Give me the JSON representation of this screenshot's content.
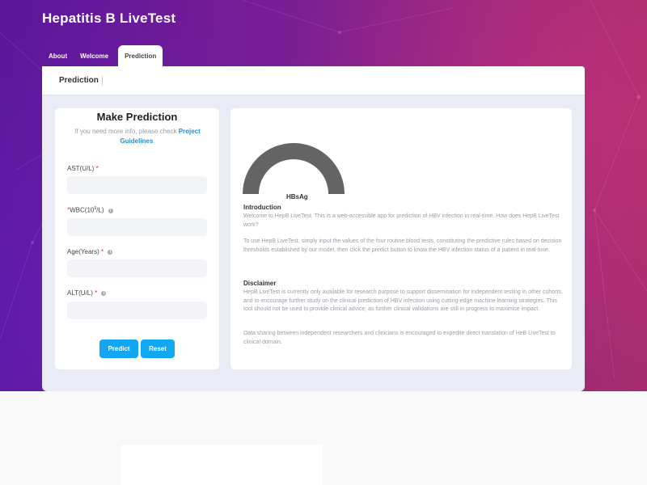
{
  "app": {
    "title": "Hepatitis B LiveTest"
  },
  "tabs": [
    {
      "label": "About"
    },
    {
      "label": "Welcome"
    },
    {
      "label": "Prediction"
    }
  ],
  "card": {
    "header_title": "Prediction"
  },
  "form": {
    "heading": "Make Prediction",
    "note_prefix": "If you need more info, please check ",
    "note_link": "Project Guidelines",
    "note_suffix": ".",
    "fields": [
      {
        "label": "AST(U/L)",
        "required": "*",
        "value": ""
      },
      {
        "label_pre": "WBC(10",
        "label_sup": "9",
        "label_post": "/L)",
        "required": "*",
        "value": ""
      },
      {
        "label": "Age(Years)",
        "required": "*",
        "value": ""
      },
      {
        "label": "ALT(U/L)",
        "required": "*",
        "value": ""
      }
    ],
    "predict_label": "Predict",
    "reset_label": "Reset"
  },
  "result": {
    "gauge_label": "HBsAg",
    "gauge_color": "#646464",
    "intro_title": "Introduction",
    "intro_p1": "Welcome to HepB LiveTest. This is a web-accessible app for prediction of HBV infection in real-time. How does HepB LiveTest work?",
    "intro_p2": "To use HepB LiveTest, simply input the values of the four routine blood tests, constituting the predictive rules based on decision thresholds established by our model, then click the predict button to know the HBV infection status of a patient in real-time.",
    "disclaimer_title": "Disclaimer",
    "disclaimer_p1": "HepB LiveTest is currently only available for research purpose to support dissemination for independent testing in other cohorts, and to encourage further study on the clinical prediction of HBV infection using cutting-edge machine learning strategies. This tool should not be used to provide clinical advice; as further clinical validations are still in progress to maximise impact.",
    "disclaimer_p2": "Data sharing between independent researchers and clinicians is encouraged to expedite direct translation of HeB LiveTest to clinical domain."
  },
  "colors": {
    "accent": "#11a7f5",
    "required": "#e4294b",
    "link": "#1f8fe0"
  },
  "icons": {
    "info": "info-icon"
  }
}
